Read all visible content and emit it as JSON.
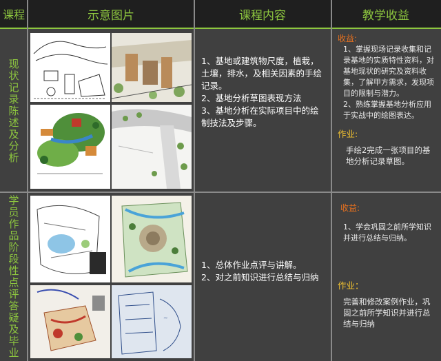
{
  "header": {
    "course": "课程",
    "images": "示意图片",
    "content": "课程内容",
    "gains": "教学收益"
  },
  "rows": [
    {
      "course": "现状记录陈述及分析",
      "content_lines": [
        "1、基地或建筑物尺度，植栽，土壤，排水，及相关因素的手绘记录。",
        "2、基地分析草图表现方法",
        "3、基地分析在实际项目中的绘制技法及步骤。"
      ],
      "gain_title": "收益:",
      "gain_lines": [
        "1、掌握现场记录收集和记录基地的实质特性资料，对基地现状的研究及资料收集，了解甲方需求，发现项目的限制与潜力。",
        "2、熟练掌握基地分析应用于实战中的绘图表达。"
      ],
      "work_title": "作业:",
      "work_text": "手绘2完成一张项目的基地分析记录草图。"
    },
    {
      "course": "学员作品阶段性点评答疑及毕业",
      "content_lines": [
        "1、总体作业点评与讲解。",
        "2、对之前知识进行总结与归纳"
      ],
      "gain_title": "收益:",
      "gain_lines": [
        "1、学会巩固之前所学知识并进行总结与归纳。"
      ],
      "work_title": "作业：",
      "work_text": "完善和修改案例作业，巩固之前所学知识并进行总结与归纳"
    }
  ],
  "colors": {
    "accent_green": "#8dc63f",
    "gain_orange": "#e8711f",
    "work_yellow": "#f2c230"
  }
}
